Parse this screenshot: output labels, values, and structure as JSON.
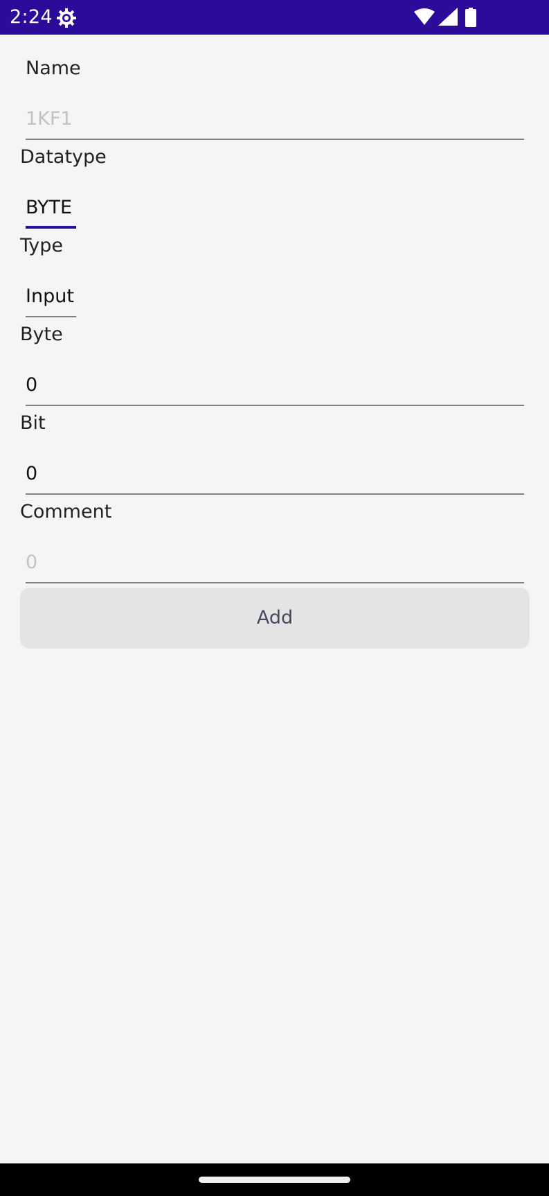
{
  "status_bar": {
    "time": "2:24",
    "background_color": "#2a0b9a",
    "icons": [
      "settings-icon",
      "wifi-icon",
      "signal-icon",
      "battery-icon"
    ]
  },
  "form": {
    "name": {
      "label": "Name",
      "placeholder": "1KF1",
      "value": ""
    },
    "datatype": {
      "label": "Datatype",
      "value": "BYTE"
    },
    "type": {
      "label": "Type",
      "value": "Input"
    },
    "byte": {
      "label": "Byte",
      "value": "0"
    },
    "bit": {
      "label": "Bit",
      "value": "0"
    },
    "comment": {
      "label": "Comment",
      "placeholder": "0",
      "value": ""
    },
    "add_label": "Add"
  },
  "colors": {
    "accent": "#2a0b9a",
    "background": "#f5f5f5",
    "button_background": "#e4e4e4",
    "button_text": "#434a5e"
  }
}
